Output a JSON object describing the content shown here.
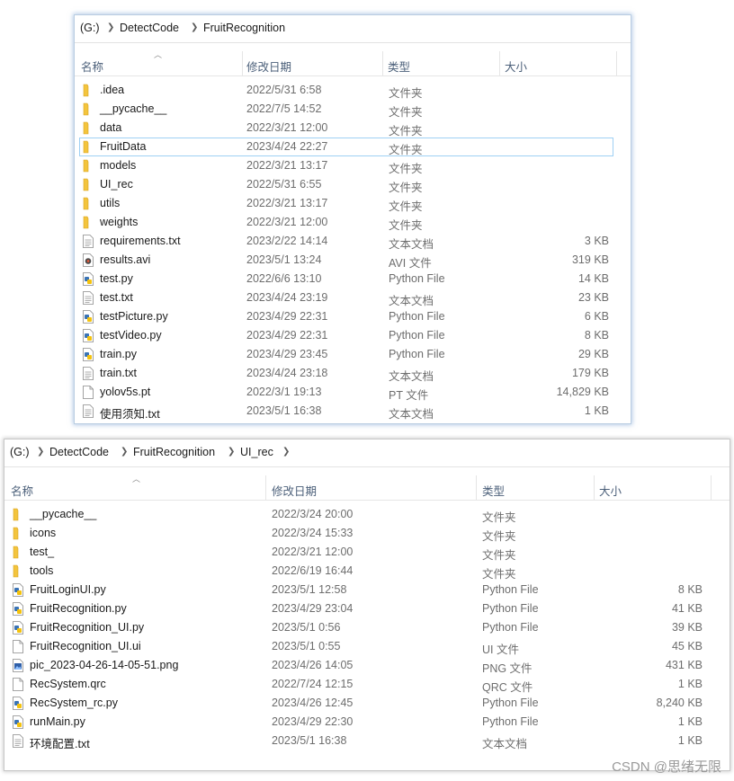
{
  "window1": {
    "breadcrumb": [
      "(G:)",
      "DetectCode",
      "FruitRecognition"
    ],
    "columns": {
      "name": "名称",
      "date": "修改日期",
      "type": "类型",
      "size": "大小"
    },
    "selected_index": 3,
    "files": [
      {
        "name": ".idea",
        "date": "2022/5/31 6:58",
        "type": "文件夹",
        "size": "",
        "icon": "folder-icon"
      },
      {
        "name": "__pycache__",
        "date": "2022/7/5 14:52",
        "type": "文件夹",
        "size": "",
        "icon": "folder-icon"
      },
      {
        "name": "data",
        "date": "2022/3/21 12:00",
        "type": "文件夹",
        "size": "",
        "icon": "folder-icon"
      },
      {
        "name": "FruitData",
        "date": "2023/4/24 22:27",
        "type": "文件夹",
        "size": "",
        "icon": "folder-icon"
      },
      {
        "name": "models",
        "date": "2022/3/21 13:17",
        "type": "文件夹",
        "size": "",
        "icon": "folder-icon"
      },
      {
        "name": "UI_rec",
        "date": "2022/5/31 6:55",
        "type": "文件夹",
        "size": "",
        "icon": "folder-icon"
      },
      {
        "name": "utils",
        "date": "2022/3/21 13:17",
        "type": "文件夹",
        "size": "",
        "icon": "folder-icon"
      },
      {
        "name": "weights",
        "date": "2022/3/21 12:00",
        "type": "文件夹",
        "size": "",
        "icon": "folder-icon"
      },
      {
        "name": "requirements.txt",
        "date": "2023/2/22 14:14",
        "type": "文本文档",
        "size": "3 KB",
        "icon": "text-file-icon"
      },
      {
        "name": "results.avi",
        "date": "2023/5/1 13:24",
        "type": "AVI 文件",
        "size": "319 KB",
        "icon": "video-file-icon"
      },
      {
        "name": "test.py",
        "date": "2022/6/6 13:10",
        "type": "Python File",
        "size": "14 KB",
        "icon": "python-file-icon"
      },
      {
        "name": "test.txt",
        "date": "2023/4/24 23:19",
        "type": "文本文档",
        "size": "23 KB",
        "icon": "text-file-icon"
      },
      {
        "name": "testPicture.py",
        "date": "2023/4/29 22:31",
        "type": "Python File",
        "size": "6 KB",
        "icon": "python-file-icon"
      },
      {
        "name": "testVideo.py",
        "date": "2023/4/29 22:31",
        "type": "Python File",
        "size": "8 KB",
        "icon": "python-file-icon"
      },
      {
        "name": "train.py",
        "date": "2023/4/29 23:45",
        "type": "Python File",
        "size": "29 KB",
        "icon": "python-file-icon"
      },
      {
        "name": "train.txt",
        "date": "2023/4/24 23:18",
        "type": "文本文档",
        "size": "179 KB",
        "icon": "text-file-icon"
      },
      {
        "name": "yolov5s.pt",
        "date": "2022/3/1 19:13",
        "type": "PT 文件",
        "size": "14,829 KB",
        "icon": "blank-file-icon"
      },
      {
        "name": "使用须知.txt",
        "date": "2023/5/1 16:38",
        "type": "文本文档",
        "size": "1 KB",
        "icon": "text-file-icon"
      }
    ]
  },
  "window2": {
    "breadcrumb": [
      "(G:)",
      "DetectCode",
      "FruitRecognition",
      "UI_rec"
    ],
    "columns": {
      "name": "名称",
      "date": "修改日期",
      "type": "类型",
      "size": "大小"
    },
    "selected_index": -1,
    "files": [
      {
        "name": "__pycache__",
        "date": "2022/3/24 20:00",
        "type": "文件夹",
        "size": "",
        "icon": "folder-icon"
      },
      {
        "name": "icons",
        "date": "2022/3/24 15:33",
        "type": "文件夹",
        "size": "",
        "icon": "folder-icon"
      },
      {
        "name": "test_",
        "date": "2022/3/21 12:00",
        "type": "文件夹",
        "size": "",
        "icon": "folder-icon"
      },
      {
        "name": "tools",
        "date": "2022/6/19 16:44",
        "type": "文件夹",
        "size": "",
        "icon": "folder-icon"
      },
      {
        "name": "FruitLoginUI.py",
        "date": "2023/5/1 12:58",
        "type": "Python File",
        "size": "8 KB",
        "icon": "python-file-icon"
      },
      {
        "name": "FruitRecognition.py",
        "date": "2023/4/29 23:04",
        "type": "Python File",
        "size": "41 KB",
        "icon": "python-file-icon"
      },
      {
        "name": "FruitRecognition_UI.py",
        "date": "2023/5/1 0:56",
        "type": "Python File",
        "size": "39 KB",
        "icon": "python-file-icon"
      },
      {
        "name": "FruitRecognition_UI.ui",
        "date": "2023/5/1 0:55",
        "type": "UI 文件",
        "size": "45 KB",
        "icon": "blank-file-icon"
      },
      {
        "name": "pic_2023-04-26-14-05-51.png",
        "date": "2023/4/26 14:05",
        "type": "PNG 文件",
        "size": "431 KB",
        "icon": "image-file-icon"
      },
      {
        "name": "RecSystem.qrc",
        "date": "2022/7/24 12:15",
        "type": "QRC 文件",
        "size": "1 KB",
        "icon": "blank-file-icon"
      },
      {
        "name": "RecSystem_rc.py",
        "date": "2023/4/26 12:45",
        "type": "Python File",
        "size": "8,240 KB",
        "icon": "python-file-icon"
      },
      {
        "name": "runMain.py",
        "date": "2023/4/29 22:30",
        "type": "Python File",
        "size": "1 KB",
        "icon": "python-file-icon"
      },
      {
        "name": "环境配置.txt",
        "date": "2023/5/1 16:38",
        "type": "文本文档",
        "size": "1 KB",
        "icon": "text-file-icon"
      }
    ]
  },
  "watermark": "CSDN @思绪无限",
  "colors": {
    "folder": "#f3c43d",
    "selection_border": "#9fd0f4",
    "header_text": "#4c607a",
    "secondary_text": "#6d6d6d"
  }
}
